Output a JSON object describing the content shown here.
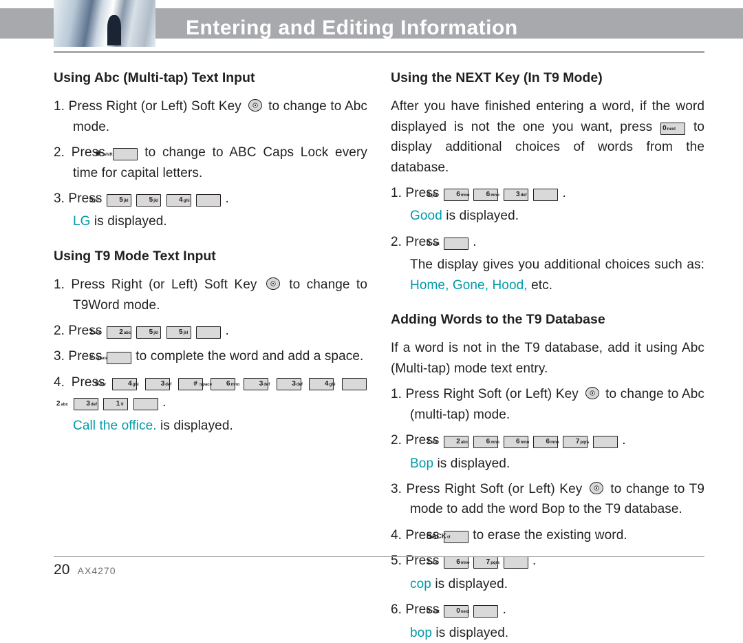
{
  "header": {
    "title": "Entering and Editing Information"
  },
  "footer": {
    "page": "20",
    "model": "AX4270"
  },
  "keys": {
    "star": "✱ ↑shift",
    "hash": "# ↕space",
    "back": "BACK ↺",
    "0": "0 next",
    "1": "1 ⚲",
    "2": "2 abc",
    "3": "3 def",
    "4": "4 ghi",
    "5": "5 jkl",
    "6": "6 mno",
    "7": "7 pqrs",
    "8": "8 tuv"
  },
  "left": {
    "abc": {
      "heading": "Using Abc (Multi-tap) Text Input",
      "items": [
        {
          "pre": "1.  Press Right (or Left) Soft Key ",
          "has_ok": true,
          "post": " to change to Abc mode."
        },
        {
          "pre": "2.  Press ",
          "keys": [
            "star"
          ],
          "post": " to change to ABC Caps Lock every time for capital letters."
        },
        {
          "pre": "3.  Press ",
          "keys": [
            "5",
            "5",
            "5",
            "4"
          ],
          "post": " .",
          "sub": {
            "teal": "LG",
            "plain": " is displayed."
          }
        }
      ]
    },
    "t9": {
      "heading": "Using T9 Mode Text Input",
      "items": [
        {
          "pre": "1.  Press Right (or Left) Soft Key ",
          "has_ok": true,
          "post": " to change to T9Word mode."
        },
        {
          "pre": "2.  Press ",
          "keys": [
            "2",
            "2",
            "5",
            "5"
          ],
          "post": " ."
        },
        {
          "pre": "3.  Press ",
          "keys": [
            "hash"
          ],
          "post": " to complete the word and add a space."
        },
        {
          "pre": "4.  Press ",
          "keys": [
            "8",
            "4",
            "3",
            "hash",
            "6",
            "3",
            "3",
            "4",
            "2",
            "3",
            "1"
          ],
          "post": " .",
          "sub": {
            "teal": "Call the office.",
            "plain": " is displayed."
          }
        }
      ]
    }
  },
  "right": {
    "next": {
      "heading": "Using the NEXT Key (In T9 Mode)",
      "intro_pre": "After you have finished entering a word, if the word displayed is not the one you want, press ",
      "intro_key": "0",
      "intro_post": " to display additional choices of words from the database.",
      "items": [
        {
          "pre": "1.  Press ",
          "keys": [
            "4",
            "6",
            "6",
            "3"
          ],
          "post": " .",
          "sub": {
            "teal": "Good",
            "plain": " is displayed."
          }
        },
        {
          "pre": "2.  Press ",
          "keys": [
            "0"
          ],
          "post": " .",
          "sub": {
            "plain_pre": "The display gives you additional choices such as: ",
            "teal": "Home, Gone, Hood,",
            "plain": " etc."
          }
        }
      ]
    },
    "add": {
      "heading": "Adding Words to the T9 Database",
      "intro": "If a word is not in the T9 database, add it using Abc (Multi-tap) mode text entry.",
      "items": [
        {
          "pre": "1.  Press Right Soft (or Left) Key ",
          "has_ok": true,
          "post": " to change to Abc (multi-tap) mode."
        },
        {
          "pre": "2.  Press ",
          "keys": [
            "2",
            "2",
            "6",
            "6",
            "6",
            "7"
          ],
          "post": " .",
          "sub": {
            "teal": "Bop",
            "plain": " is displayed."
          }
        },
        {
          "pre": "3.  Press Right Soft (or Left) Key ",
          "has_ok": true,
          "post": " to change to T9 mode to add the word Bop to the T9 database."
        },
        {
          "pre": "4.  Press ",
          "keys": [
            "back"
          ],
          "post": " to erase the existing word."
        },
        {
          "pre": "5.  Press ",
          "keys": [
            "2",
            "6",
            "7"
          ],
          "post": " .",
          "sub": {
            "teal": "cop",
            "plain": " is displayed."
          }
        },
        {
          "pre": "6.  Press ",
          "keys": [
            "0",
            "0"
          ],
          "post": " .",
          "sub": {
            "teal": "bop",
            "plain": " is displayed."
          }
        }
      ]
    }
  }
}
